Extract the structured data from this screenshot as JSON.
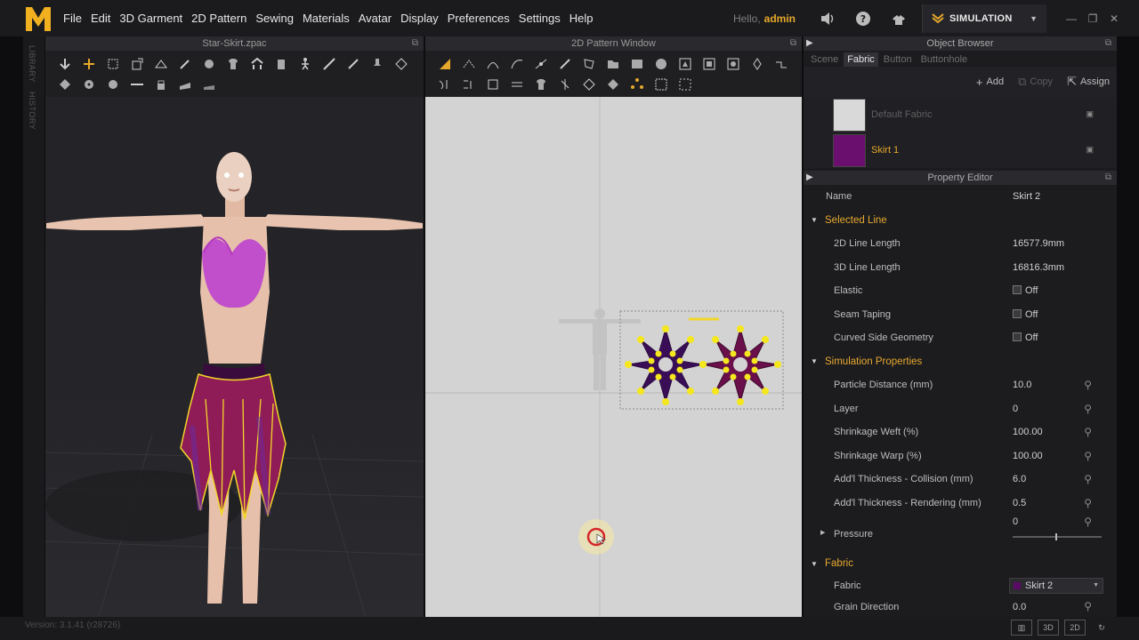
{
  "app": {
    "logo_letter": "M",
    "menu": [
      "File",
      "Edit",
      "3D Garment",
      "2D Pattern",
      "Sewing",
      "Materials",
      "Avatar",
      "Display",
      "Preferences",
      "Settings",
      "Help"
    ],
    "greeting": "Hello,",
    "username": "admin",
    "mode_label": "SIMULATION",
    "accent_color": "#e6a82a"
  },
  "left_rail": {
    "library_label": "LIBRARY",
    "history_label": "HISTORY"
  },
  "panel_3d": {
    "title": "Star-Skirt.zpac"
  },
  "panel_2d": {
    "title": "2D Pattern Window"
  },
  "object_browser": {
    "title": "Object Browser",
    "tabs": [
      {
        "label": "Scene",
        "active": false
      },
      {
        "label": "Fabric",
        "active": true
      },
      {
        "label": "Button",
        "active": false
      },
      {
        "label": "Buttonhole",
        "active": false
      }
    ],
    "actions": {
      "add": "Add",
      "copy": "Copy",
      "assign": "Assign"
    },
    "fabrics": [
      {
        "name": "Default Fabric",
        "color": "#d9d9d9",
        "text_color": "#5f5f5f"
      },
      {
        "name": "Skirt 1",
        "color": "#6b0f6e",
        "text_color": "#e6a82a"
      }
    ]
  },
  "property_editor": {
    "title": "Property Editor",
    "name_label": "Name",
    "name_value": "Skirt 2",
    "sections": {
      "selected_line": "Selected Line",
      "simulation": "Simulation Properties",
      "fabric": "Fabric"
    },
    "selected_line": {
      "line_2d_label": "2D Line Length",
      "line_2d_value": "16577.9mm",
      "line_3d_label": "3D Line Length",
      "line_3d_value": "16816.3mm",
      "elastic_label": "Elastic",
      "elastic_value": "Off",
      "seam_label": "Seam Taping",
      "seam_value": "Off",
      "curved_label": "Curved Side Geometry",
      "curved_value": "Off"
    },
    "simulation": {
      "particle_label": "Particle Distance (mm)",
      "particle_value": "10.0",
      "layer_label": "Layer",
      "layer_value": "0",
      "weft_label": "Shrinkage Weft (%)",
      "weft_value": "100.00",
      "warp_label": "Shrinkage Warp (%)",
      "warp_value": "100.00",
      "collision_label": "Add'l Thickness - Collision (mm)",
      "collision_value": "6.0",
      "rendering_label": "Add'l Thickness - Rendering (mm)",
      "rendering_value": "0.5",
      "pressure_label": "Pressure",
      "pressure_value": "0"
    },
    "fabric": {
      "fabric_label": "Fabric",
      "fabric_value": "Skirt 2",
      "grain_label": "Grain Direction",
      "grain_value": "0.0"
    }
  },
  "status": {
    "version": "Version: 3.1.41 (r28726)"
  }
}
